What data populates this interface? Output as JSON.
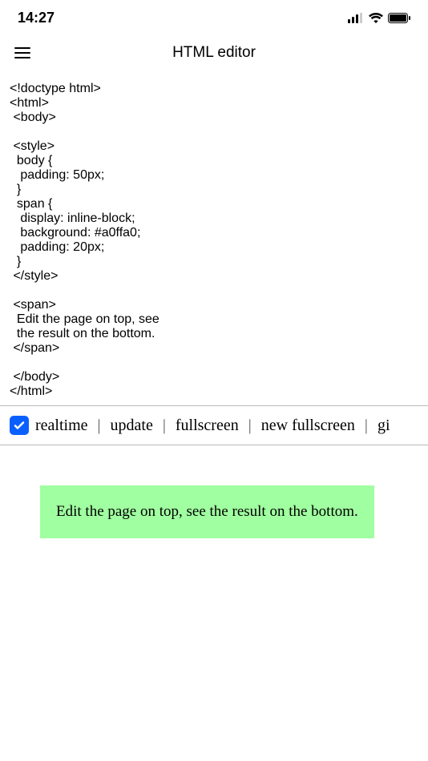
{
  "status": {
    "time": "14:27"
  },
  "header": {
    "title": "HTML editor"
  },
  "editor": {
    "code": "<!doctype html>\n<html>\n <body>\n\n <style>\n  body {\n   padding: 50px;\n  }\n  span {\n   display: inline-block;\n   background: #a0ffa0;\n   padding: 20px;\n  }\n </style>\n\n <span>\n  Edit the page on top, see\n  the result on the bottom.\n </span>\n\n </body>\n</html>"
  },
  "toolbar": {
    "realtime": "realtime",
    "update": "update",
    "fullscreen": "fullscreen",
    "new_fullscreen": "new fullscreen",
    "gi": "gi",
    "sep": "|"
  },
  "preview": {
    "span_text": "Edit the page on top, see the result on the bottom."
  }
}
